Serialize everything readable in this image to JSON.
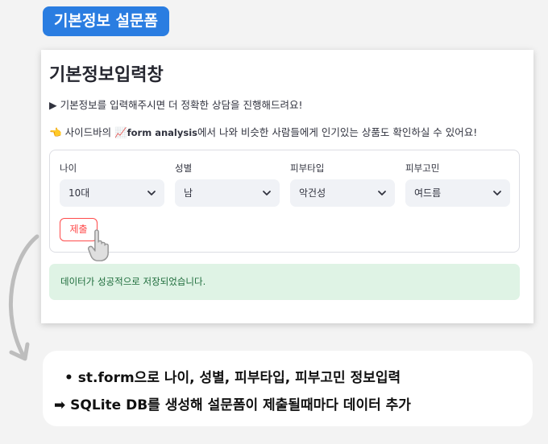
{
  "header": {
    "pill_label": "기본정보 설문폼"
  },
  "app": {
    "title": "기본정보입력창",
    "intro_arrow": "▶",
    "intro_text": "기본정보를 입력해주시면 더 정확한 상담을 진행해드려요!",
    "sidebar_hint_emoji": "👈",
    "sidebar_hint_prefix": "사이드바의",
    "chart_emoji": "📈",
    "sidebar_page_name": "form analysis",
    "sidebar_hint_suffix": "에서 나와 비슷한 사람들에게 인기있는 상품도 확인하실 수 있어요!",
    "form": {
      "fields": [
        {
          "label": "나이",
          "value": "10대"
        },
        {
          "label": "성별",
          "value": "남"
        },
        {
          "label": "피부타입",
          "value": "악건성"
        },
        {
          "label": "피부고민",
          "value": "여드름"
        }
      ],
      "submit_label": "제출"
    },
    "success_message": "데이터가 성공적으로 저장되었습니다."
  },
  "note": {
    "bullet": "•",
    "line1": "st.form으로 나이, 성별, 피부타입, 피부고민 정보입력",
    "arrow": "➡",
    "line2": "SQLite DB를 생성해 설문폼이 제출될때마다 데이터 추가"
  },
  "colors": {
    "pill_bg": "#2a7de1",
    "submit_accent": "#ff4b4b",
    "success_bg": "#dff3e5",
    "success_text": "#1c6b3a",
    "select_bg": "#f0f2f6"
  },
  "icons": [
    "chevron-down-icon",
    "hand-pointer-icon",
    "curved-arrow-icon",
    "right-arrow-icon"
  ]
}
